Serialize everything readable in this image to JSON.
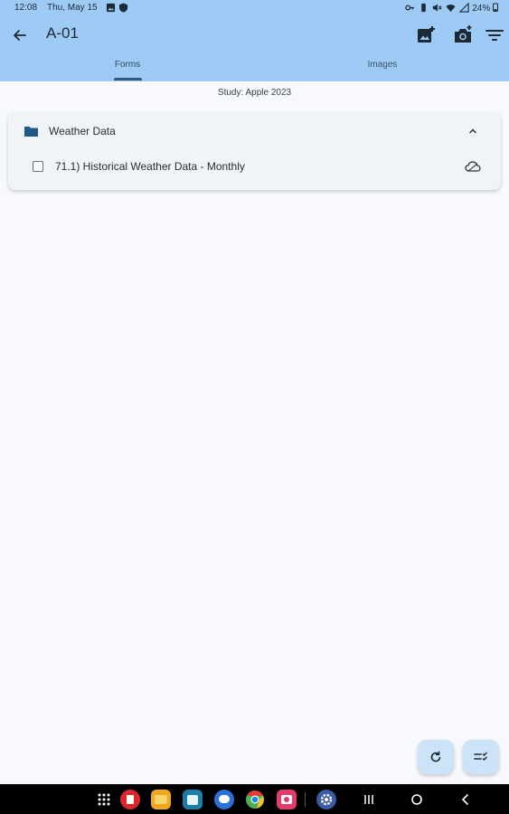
{
  "status_bar": {
    "time": "12:08",
    "date": "Thu, May 15",
    "battery": "24%"
  },
  "app_bar": {
    "title": "A-01",
    "actions": [
      "back-arrow-icon",
      "add-image-icon",
      "camera-icon",
      "filter-icon"
    ]
  },
  "tabs": [
    {
      "label": "Forms",
      "selected": true
    },
    {
      "label": "Images",
      "selected": false
    }
  ],
  "study_label": "Study: Apple 2023",
  "group": {
    "title": "Weather Data",
    "expanded": true,
    "items": [
      {
        "label": "71.1) Historical Weather Data - Monthly",
        "checked": false
      }
    ]
  },
  "colors": {
    "app_bar": "#9ecbf6",
    "background": "#f7f9fc",
    "card": "#f0f3f7",
    "fab": "#cde3f7",
    "accent": "#2f5b7e"
  },
  "dock_apps": [
    {
      "name": "apps-grid-icon",
      "color": "#000000"
    },
    {
      "name": "flipboard-icon",
      "color": "#e0262b"
    },
    {
      "name": "files-icon",
      "color": "#f2a81d"
    },
    {
      "name": "calendar-icon",
      "color": "#1b7ea8"
    },
    {
      "name": "messages-icon",
      "color": "#2c6fd8"
    },
    {
      "name": "chrome-icon",
      "color": "#4caf50"
    },
    {
      "name": "screen-recorder-icon",
      "color": "#e53c6b"
    },
    {
      "name": "settings-icon",
      "color": "#3b5ba6"
    }
  ]
}
